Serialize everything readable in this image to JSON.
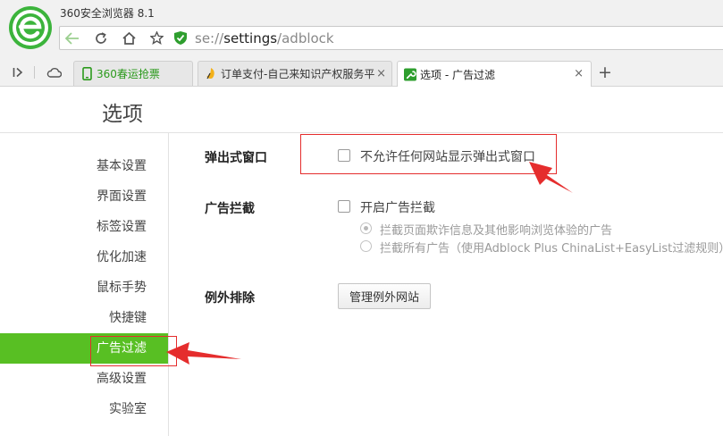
{
  "window": {
    "title": "360安全浏览器 8.1"
  },
  "address": {
    "scheme": "se://",
    "host": "settings",
    "path": "/adblock"
  },
  "tabs": [
    {
      "label": "360春运抢票",
      "active": false
    },
    {
      "label": "订单支付-自己来知识产权服务平",
      "active": false
    },
    {
      "label": "选项 - 广告过滤",
      "active": true
    }
  ],
  "tab_close_glyph": "×",
  "new_tab_glyph": "+",
  "page": {
    "title": "选项"
  },
  "nav": {
    "items": [
      {
        "label": "基本设置"
      },
      {
        "label": "界面设置"
      },
      {
        "label": "标签设置"
      },
      {
        "label": "优化加速"
      },
      {
        "label": "鼠标手势"
      },
      {
        "label": "快捷键"
      },
      {
        "label": "广告过滤",
        "active": true
      },
      {
        "label": "高级设置"
      },
      {
        "label": "实验室"
      }
    ]
  },
  "popup": {
    "section_label": "弹出式窗口",
    "checkbox_label": "不允许任何网站显示弹出式窗口",
    "checked": false
  },
  "adblock": {
    "section_label": "广告拦截",
    "checkbox_label": "开启广告拦截",
    "checked": false,
    "options": [
      {
        "label": "拦截页面欺诈信息及其他影响浏览体验的广告",
        "selected": true
      },
      {
        "label": "拦截所有广告（使用Adblock Plus ChinaList+EasyList过滤规则）",
        "selected": false
      }
    ]
  },
  "exceptions": {
    "section_label": "例外排除",
    "button_label": "管理例外网站"
  },
  "colors": {
    "accent_green": "#58bf23",
    "annotation_red": "#e52d2d"
  },
  "icons": {
    "logo": "360-browser-logo-icon",
    "back": "arrow-left-icon",
    "refresh": "refresh-icon",
    "home": "home-icon",
    "favorite": "star-icon",
    "secure": "shield-check-icon",
    "sidebar": "sidebar-toggle-icon",
    "cloud": "cloud-icon"
  }
}
